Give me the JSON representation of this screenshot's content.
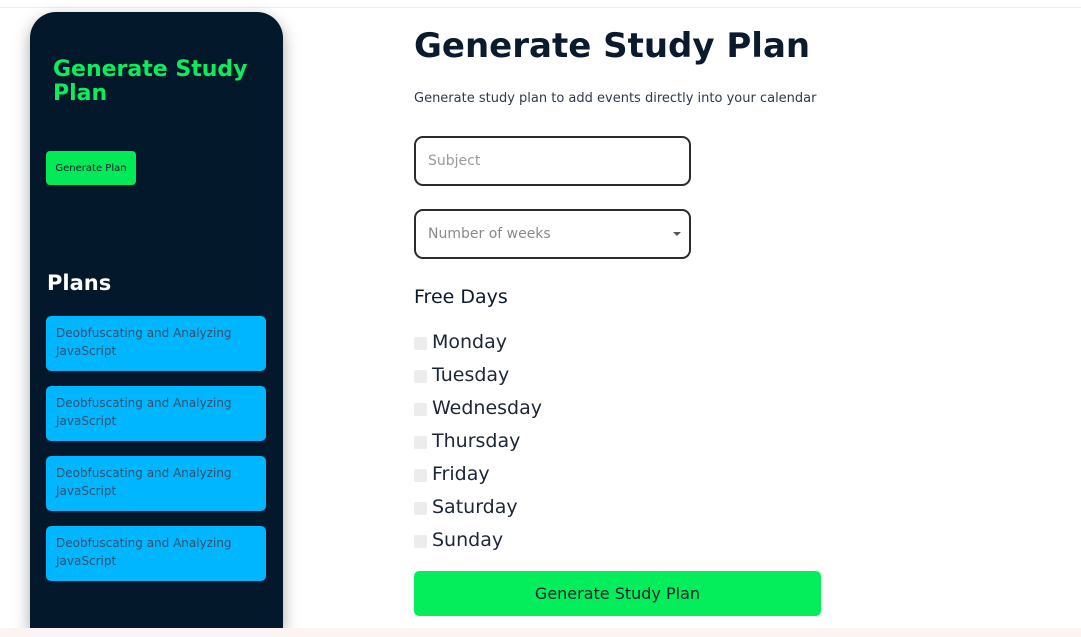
{
  "sidebar": {
    "title": "Generate Study Plan",
    "generate_button": "Generate Plan",
    "plans_heading": "Plans",
    "plans": [
      {
        "label": "Deobfuscating and Analyzing JavaScript"
      },
      {
        "label": "Deobfuscating and Analyzing JavaScript"
      },
      {
        "label": "Deobfuscating and Analyzing JavaScript"
      },
      {
        "label": "Deobfuscating and Analyzing JavaScript"
      }
    ]
  },
  "main": {
    "title": "Generate Study Plan",
    "subtitle": "Generate study plan to add events directly into your calendar",
    "subject": {
      "placeholder": "Subject",
      "value": ""
    },
    "weeks": {
      "placeholder": "Number of weeks"
    },
    "free_days_heading": "Free Days",
    "days": [
      {
        "label": "Monday",
        "checked": false
      },
      {
        "label": "Tuesday",
        "checked": false
      },
      {
        "label": "Wednesday",
        "checked": false
      },
      {
        "label": "Thursday",
        "checked": false
      },
      {
        "label": "Friday",
        "checked": false
      },
      {
        "label": "Saturday",
        "checked": false
      },
      {
        "label": "Sunday",
        "checked": false
      }
    ],
    "submit_button": "Generate Study Plan"
  },
  "colors": {
    "sidebar_bg": "#04182b",
    "accent_green": "#04e958",
    "plan_blue": "#00b6ff",
    "title_green": "#0dec5c"
  }
}
